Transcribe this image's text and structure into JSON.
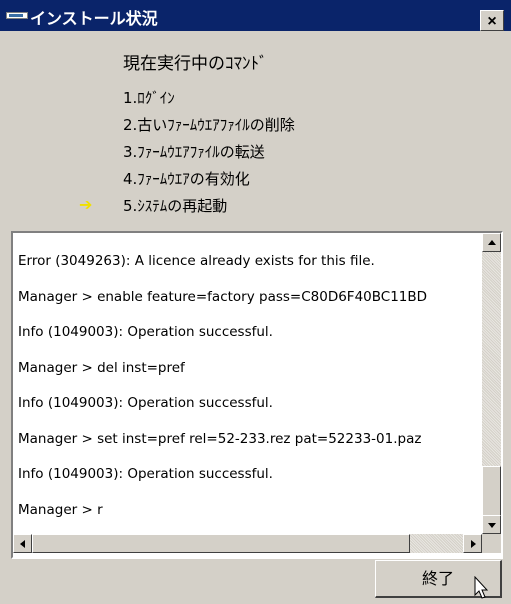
{
  "window": {
    "title": "インストール状況",
    "close_glyph": "×"
  },
  "steps": {
    "heading": "現在実行中のｺﾏﾝﾄﾞ",
    "items": [
      "1.ﾛｸﾞｲﾝ",
      "2.古いﾌｧｰﾑｳｴｱﾌｧｲﾙの削除",
      "3.ﾌｧｰﾑｳｴｱﾌｧｲﾙの転送",
      "4.ﾌｧｰﾑｳｴｱの有効化",
      "5.ｼｽﾃﾑの再起動"
    ],
    "current_marker": "➔"
  },
  "log": {
    "lines": [
      "Error (3049263): A licence already exists for this file.",
      "Manager > enable feature=factory pass=C80D6F40BC11BD",
      "Info (1049003): Operation successful.",
      "Manager > del inst=pref",
      "Info (1049003): Operation successful.",
      "Manager > set inst=pref rel=52-233.rez pat=52233-01.paz",
      "Info (1049003): Operation successful.",
      "Manager > r"
    ]
  },
  "footer": {
    "finish_label": "終了"
  },
  "colors": {
    "titlebar": "#0a246a",
    "face": "#d4d0c8",
    "marker": "#f0e000"
  }
}
